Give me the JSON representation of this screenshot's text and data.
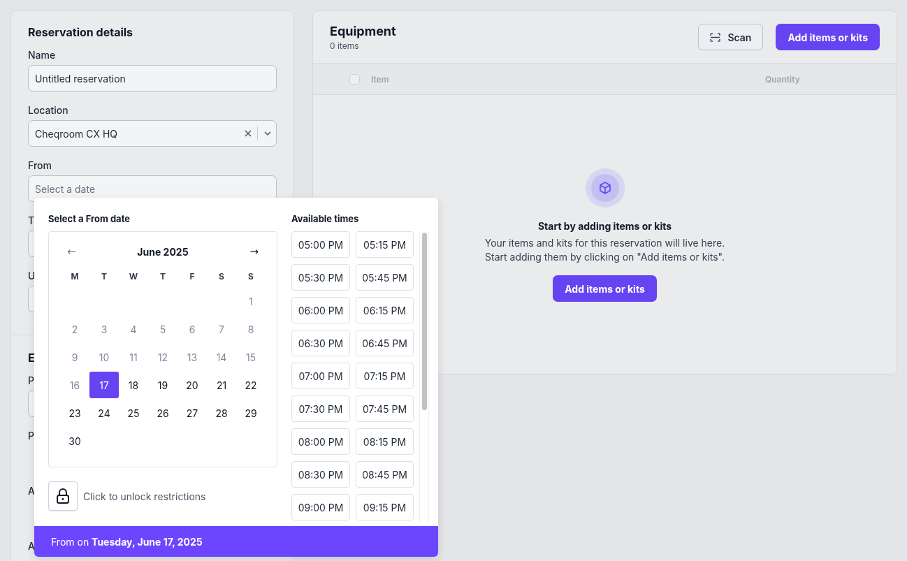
{
  "reservation_details": {
    "title": "Reservation details",
    "fields": [
      {
        "kind": "input",
        "label": "Name",
        "value": "Untitled reservation"
      },
      {
        "kind": "select",
        "label": "Location",
        "value": "Cheqroom CX HQ"
      },
      {
        "kind": "input",
        "label": "From",
        "placeholder": "Select a date"
      },
      {
        "kind": "input",
        "label": "T"
      },
      {
        "kind": "input",
        "label": "U"
      }
    ]
  },
  "second_section": {
    "title": "E",
    "fields": [
      {
        "kind": "input",
        "label": "P"
      },
      {
        "kind": "blank",
        "label": "P"
      },
      {
        "kind": "blank",
        "label": "A"
      },
      {
        "kind": "blank",
        "label": "A"
      }
    ]
  },
  "date_picker": {
    "title": "Select a From date",
    "month": "June 2025",
    "prev": "←",
    "next": "→",
    "weekdays": [
      "M",
      "T",
      "W",
      "T",
      "F",
      "S",
      "S"
    ],
    "weeks": [
      {
        "kind": "first",
        "days": [
          {
            "label": "1",
            "disabled": true,
            "selected": false
          }
        ]
      },
      {
        "kind": "week",
        "days": [
          {
            "label": "2",
            "disabled": true,
            "selected": false
          },
          {
            "label": "3",
            "disabled": true,
            "selected": false
          },
          {
            "label": "4",
            "disabled": true,
            "selected": false
          },
          {
            "label": "5",
            "disabled": true,
            "selected": false
          },
          {
            "label": "6",
            "disabled": true,
            "selected": false
          },
          {
            "label": "7",
            "disabled": true,
            "selected": false
          },
          {
            "label": "8",
            "disabled": true,
            "selected": false
          }
        ]
      },
      {
        "kind": "week",
        "days": [
          {
            "label": "9",
            "disabled": true,
            "selected": false
          },
          {
            "label": "10",
            "disabled": true,
            "selected": false
          },
          {
            "label": "11",
            "disabled": true,
            "selected": false
          },
          {
            "label": "12",
            "disabled": true,
            "selected": false
          },
          {
            "label": "13",
            "disabled": true,
            "selected": false
          },
          {
            "label": "14",
            "disabled": true,
            "selected": false
          },
          {
            "label": "15",
            "disabled": true,
            "selected": false
          }
        ]
      },
      {
        "kind": "week",
        "days": [
          {
            "label": "16",
            "disabled": true,
            "selected": false
          },
          {
            "label": "17",
            "disabled": false,
            "selected": true
          },
          {
            "label": "18",
            "disabled": false,
            "selected": false
          },
          {
            "label": "19",
            "disabled": false,
            "selected": false
          },
          {
            "label": "20",
            "disabled": false,
            "selected": false
          },
          {
            "label": "21",
            "disabled": false,
            "selected": false
          },
          {
            "label": "22",
            "disabled": false,
            "selected": false
          }
        ]
      },
      {
        "kind": "week",
        "days": [
          {
            "label": "23",
            "disabled": false,
            "selected": false
          },
          {
            "label": "24",
            "disabled": false,
            "selected": false
          },
          {
            "label": "25",
            "disabled": false,
            "selected": false
          },
          {
            "label": "26",
            "disabled": false,
            "selected": false
          },
          {
            "label": "27",
            "disabled": false,
            "selected": false
          },
          {
            "label": "28",
            "disabled": false,
            "selected": false
          },
          {
            "label": "29",
            "disabled": false,
            "selected": false
          }
        ]
      },
      {
        "kind": "week",
        "days": [
          {
            "label": "30",
            "disabled": false,
            "selected": false
          }
        ]
      }
    ],
    "unlock_text": "Click to unlock restrictions",
    "times_title": "Available times",
    "times": [
      "05:00 PM",
      "05:15 PM",
      "05:30 PM",
      "05:45 PM",
      "06:00 PM",
      "06:15 PM",
      "06:30 PM",
      "06:45 PM",
      "07:00 PM",
      "07:15 PM",
      "07:30 PM",
      "07:45 PM",
      "08:00 PM",
      "08:15 PM",
      "08:30 PM",
      "08:45 PM",
      "09:00 PM",
      "09:15 PM"
    ],
    "footer": "From on **Tuesday, June 17, 2025**"
  },
  "equipment": {
    "title": "Equipment",
    "count": "0 items",
    "scan_button": "Scan",
    "add_button": "Add items or kits",
    "columns": [
      "Item",
      "Quantity"
    ],
    "select_all_checked": false,
    "empty_state": {
      "title": "Start by adding items or kits",
      "text_lines": [
        "Your items and kits for this reservation will live here.",
        "Start adding them by clicking on \"Add items or kits\"."
      ],
      "button": "Add items or kits"
    }
  }
}
